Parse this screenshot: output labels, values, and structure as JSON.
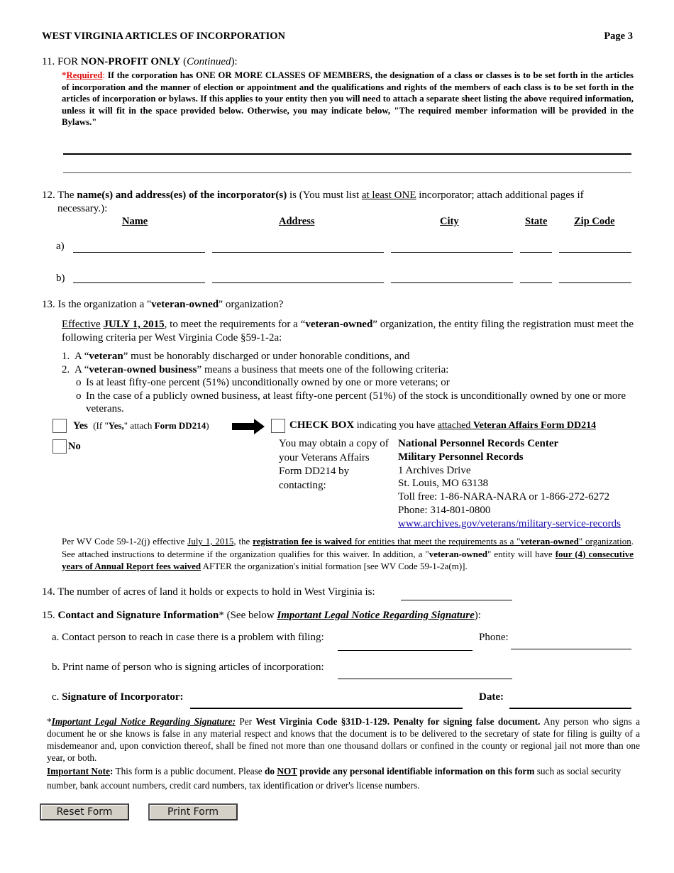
{
  "header": {
    "title": "WEST VIRGINIA ARTICLES OF INCORPORATION",
    "page": "Page 3"
  },
  "s11": {
    "num": "11. FOR ",
    "bold": "NON-PROFIT ONLY",
    "paren_open": " (",
    "italic": "Continued",
    "paren_close": "):",
    "required_star": "*",
    "required_label": "Required",
    "required_colon": ": ",
    "text": "If the corporation has ONE OR MORE CLASSES OF MEMBERS, the designation of a class or classes is to be set forth in the articles of incorporation and the manner of election or appointment and the qualifications and rights of the members of each class is to be set forth in the articles of incorporation or bylaws. If this applies to your entity then you will need to attach a separate sheet listing the above required information, unless it will fit in the space provided below. Otherwise, you may indicate below, \"The required member information will be provided in the Bylaws.\"",
    "line1_value": "",
    "line2_value": ""
  },
  "s12": {
    "pre": "12. The ",
    "bold": "name(s) and address(es) of the incorporator(s)",
    "mid": " is (You must list ",
    "underline": "at least ONE",
    "post": " incorporator; attach additional pages if",
    "line2": "necessary.):",
    "columns": [
      "Name",
      "Address",
      "City",
      "State",
      "Zip Code"
    ],
    "rows": [
      {
        "label": "a)",
        "name": "",
        "address": "",
        "city": "",
        "state": "",
        "zip": ""
      },
      {
        "label": "b)",
        "name": "",
        "address": "",
        "city": "",
        "state": "",
        "zip": ""
      }
    ]
  },
  "s13": {
    "q_pre": "13.  Is the organization a \"",
    "q_bold": "veteran-owned",
    "q_post": "\" organization?",
    "eff_u": "Effective",
    "eff_date": "JULY 1, 2015",
    "eff_text1": ", to meet the requirements for a “",
    "eff_bold": "veteran-owned",
    "eff_text2": "” organization, the entity filing the registration must meet the following criteria per West Virginia Code §59-1-2a:",
    "item1_num": "1.",
    "item1_pre": "A “",
    "item1_bold": "veteran",
    "item1_post": "” must be honorably discharged or under honorable conditions, and",
    "item2_num": "2.",
    "item2_pre": "A “",
    "item2_bold": "veteran-owned business",
    "item2_post": "” means a business that meets one of the following criteria:",
    "sub_bullet": "o",
    "sub1": "Is at least fifty-one percent (51%) unconditionally owned by one or more veterans; or",
    "sub2": "In the case of a publicly owned business, at least fifty-one percent (51%) of the stock is unconditionally owned by one or more veterans.",
    "yes_label": "Yes",
    "yes_note_pre": "(If \"",
    "yes_note_bold": "Yes,",
    "yes_note_mid": "\" attach ",
    "yes_note_form": "Form DD214",
    "yes_note_post": ")",
    "no_label": "No",
    "yes_checked": false,
    "no_checked": false,
    "dd214_checked": false,
    "checkbox_bold": "CHECK BOX",
    "checkbox_text": " indicating you have ",
    "checkbox_u1": "attached ",
    "checkbox_u2": "Veteran Affairs Form DD214",
    "obtain_text": "You may obtain a copy of your Veterans Affairs Form DD214 by contacting:",
    "contact": {
      "org1": "National Personnel Records Center",
      "org2": "Military Personnel Records",
      "address": "1 Archives Drive",
      "city": "St. Louis, MO 63138",
      "tollfree": "Toll free: 1-86-NARA-NARA or 1-866-272-6272",
      "phone": "Phone: 314-801-0800",
      "url": "www.archives.gov/veterans/military-service-records"
    },
    "fee_p1": "Per WV Code 59-1-2(j) effective ",
    "fee_date": "July 1, 2015",
    "fee_p2": ", the ",
    "fee_bold_u": "registration fee is waived",
    "fee_u1": " for entities that meet the requirements as a \"",
    "fee_bold2": "veteran-owned",
    "fee_u2": "\" organization",
    "fee_p3": ". See attached instructions to determine if the organization qualifies for this waiver. In addition, a \"",
    "fee_bold3": "veteran-owned",
    "fee_p4": "\" entity will have ",
    "fee_bold_u2": "four (4) consecutive years of Annual Report fees waived",
    "fee_p5": " AFTER the organization's initial formation [see WV Code 59-1-2a(m)]."
  },
  "s14": {
    "label": "14.  The number of acres of land it holds or expects to hold in West Virginia is:",
    "value": ""
  },
  "s15": {
    "num": "15. ",
    "bold": "Contact and Signature Information",
    "star": "*",
    "pre": " (See below ",
    "link": "Important Legal Notice Regarding Signature",
    "post": "):",
    "a_label": "a. Contact person to reach in case there is a problem with filing:",
    "a_value": "",
    "phone_label": "Phone:",
    "phone_value": "",
    "b_label": "b. Print name of person who is signing articles of incorporation:",
    "b_value": "",
    "c_pre": "c. ",
    "c_bold": "Signature of Incorporator:",
    "c_value": "",
    "date_label": "Date:",
    "date_value": ""
  },
  "notice": {
    "star": "*",
    "title": "Important Legal Notice Regarding Signature:",
    "per": " Per ",
    "code": "West Virginia Code §31D-1-129.",
    "penalty": " Penalty for signing false document.",
    "body": " Any person who signs a document he or she knows is false in any material respect and knows that the document is to be delivered to the secretary of state for filing is guilty of a misdemeanor and, upon conviction thereof, shall be fined not more than one thousand dollars or confined in the county or regional jail not more than one year, or both."
  },
  "note": {
    "title": "Important Note",
    "colon": ":",
    "p1": " This form is a public document. Please ",
    "do": "do ",
    "not": "NOT",
    "bold2": " provide any personal identifiable information on this form",
    "p2": " such as social security number, bank account numbers, credit card numbers, tax identification or driver's license numbers."
  },
  "buttons": {
    "reset": "Reset Form",
    "print": "Print Form"
  }
}
